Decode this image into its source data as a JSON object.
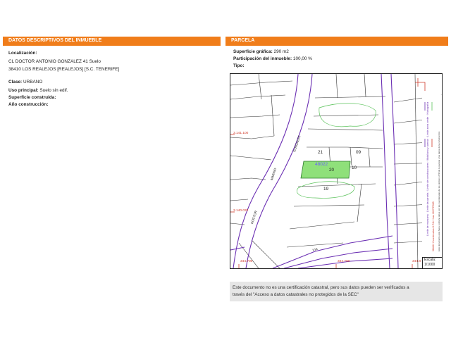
{
  "left": {
    "header": "DATOS DESCRIPTIVOS DEL INMUEBLE",
    "localizacion_label": "Localización:",
    "address_line1": "CL DOCTOR ANTONIO GONZALEZ 41 Suelo",
    "address_line2": "38410 LOS REALEJOS [REALEJOS] [S.C. TENERIFE]",
    "clase_label": "Clase:",
    "clase_value": "URBANO",
    "uso_label": "Uso principal:",
    "uso_value": "Suelo sin edif.",
    "superficie_label": "Superficie construida:",
    "anio_label": "Año construcción:"
  },
  "right": {
    "header": "PARCELA",
    "sup_label": "Superficie gráfica:",
    "sup_value": "290 m2",
    "part_label": "Participación del inmueble:",
    "part_value": "100,00 %",
    "tipo_label": "Tipo:"
  },
  "map": {
    "parcel_number": "48022",
    "lot_20": "20",
    "lot_21": "21",
    "lot_09": "09",
    "lot_10": "10",
    "lot_19": "19",
    "street_gonzalez": "GONZALEZ",
    "street_doctor": "DOCTOR",
    "street_marino": "MARINO",
    "street_via": "VIA",
    "coord_y1": "3.141.100",
    "coord_y2": "3.140.032",
    "coord_x1": "344.700",
    "coord_x2": "344.700",
    "coord_x3": "344.8",
    "escala_label": "Escala:",
    "escala_value": "1/1000",
    "legend_1": "Límite de manzana",
    "legend_2": "Límite de parcela",
    "legend_3": "Límite de construcciones",
    "legend_4": "Mobiliario y aceras",
    "legend_5": "Límite zona verde",
    "legend_6": "Hidrografía",
    "side_note_1": "Este documento está fuera contiene datos con las coordenadas de los vértices UTM de la parcela y los datos de la construcción",
    "side_note_2": "384410 Coordenadas U.T.M. Huso 28 ETRS89"
  },
  "notice": {
    "line1": "Este documento no es una certificación catastral, pero sus datos pueden ser verificados a",
    "line2": "través del \"Acceso a datos catastrales no protegidos de la SEC\""
  },
  "colors": {
    "accent": "#f07d1a",
    "purple": "#6b2fb3",
    "green_fill": "#8fe07a",
    "green_line": "#5cc35c",
    "red": "#d03b2b"
  }
}
